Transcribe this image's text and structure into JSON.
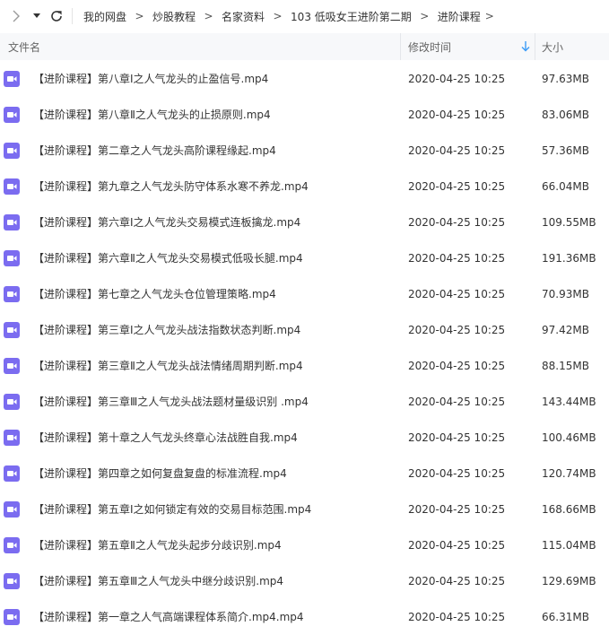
{
  "colors": {
    "accent": "#3b9cf7",
    "video_icon": "#7b6cf0",
    "header_bg": "#f7f8fa"
  },
  "nav": {
    "forward_icon": "chevron-right-icon",
    "history_icon": "caret-down-icon",
    "refresh_icon": "refresh-icon"
  },
  "breadcrumb": {
    "items": [
      "我的网盘",
      "炒股教程",
      "名家资料",
      "103 低吸女王进阶第二期",
      "进阶课程"
    ],
    "separator": ">"
  },
  "header": {
    "name": "文件名",
    "time": "修改时间",
    "size": "大小",
    "sort_icon": "sort-down-icon"
  },
  "files": [
    {
      "name": "【进阶课程】第八章Ⅰ之人气龙头的止盈信号.mp4",
      "time": "2020-04-25 10:25",
      "size": "97.63MB"
    },
    {
      "name": "【进阶课程】第八章Ⅱ之人气龙头的止损原则.mp4",
      "time": "2020-04-25 10:25",
      "size": "83.06MB"
    },
    {
      "name": "【进阶课程】第二章之人气龙头高阶课程缘起.mp4",
      "time": "2020-04-25 10:25",
      "size": "57.36MB"
    },
    {
      "name": "【进阶课程】第九章之人气龙头防守体系水寒不养龙.mp4",
      "time": "2020-04-25 10:25",
      "size": "66.04MB"
    },
    {
      "name": "【进阶课程】第六章Ⅰ之人气龙头交易模式连板擒龙.mp4",
      "time": "2020-04-25 10:25",
      "size": "109.55MB"
    },
    {
      "name": "【进阶课程】第六章Ⅱ之人气龙头交易模式低吸长腿.mp4",
      "time": "2020-04-25 10:25",
      "size": "191.36MB"
    },
    {
      "name": "【进阶课程】第七章之人气龙头仓位管理策略.mp4",
      "time": "2020-04-25 10:25",
      "size": "70.93MB"
    },
    {
      "name": "【进阶课程】第三章Ⅰ之人气龙头战法指数状态判断.mp4",
      "time": "2020-04-25 10:25",
      "size": "97.42MB"
    },
    {
      "name": "【进阶课程】第三章Ⅱ之人气龙头战法情绪周期判断.mp4",
      "time": "2020-04-25 10:25",
      "size": "88.15MB"
    },
    {
      "name": "【进阶课程】第三章Ⅲ之人气龙头战法题材量级识别 .mp4",
      "time": "2020-04-25 10:25",
      "size": "143.44MB"
    },
    {
      "name": "【进阶课程】第十章之人气龙头终章心法战胜自我.mp4",
      "time": "2020-04-25 10:25",
      "size": "100.46MB"
    },
    {
      "name": "【进阶课程】第四章之如何复盘复盘的标准流程.mp4",
      "time": "2020-04-25 10:25",
      "size": "120.74MB"
    },
    {
      "name": "【进阶课程】第五章Ⅰ之如何锁定有效的交易目标范围.mp4",
      "time": "2020-04-25 10:25",
      "size": "168.66MB"
    },
    {
      "name": "【进阶课程】第五章Ⅱ之人气龙头起步分歧识别.mp4",
      "time": "2020-04-25 10:25",
      "size": "115.04MB"
    },
    {
      "name": "【进阶课程】第五章Ⅲ之人气龙头中继分歧识别.mp4",
      "time": "2020-04-25 10:25",
      "size": "129.69MB"
    },
    {
      "name": "【进阶课程】第一章之人气高端课程体系简介.mp4.mp4",
      "time": "2020-04-25 10:25",
      "size": "66.31MB"
    }
  ]
}
